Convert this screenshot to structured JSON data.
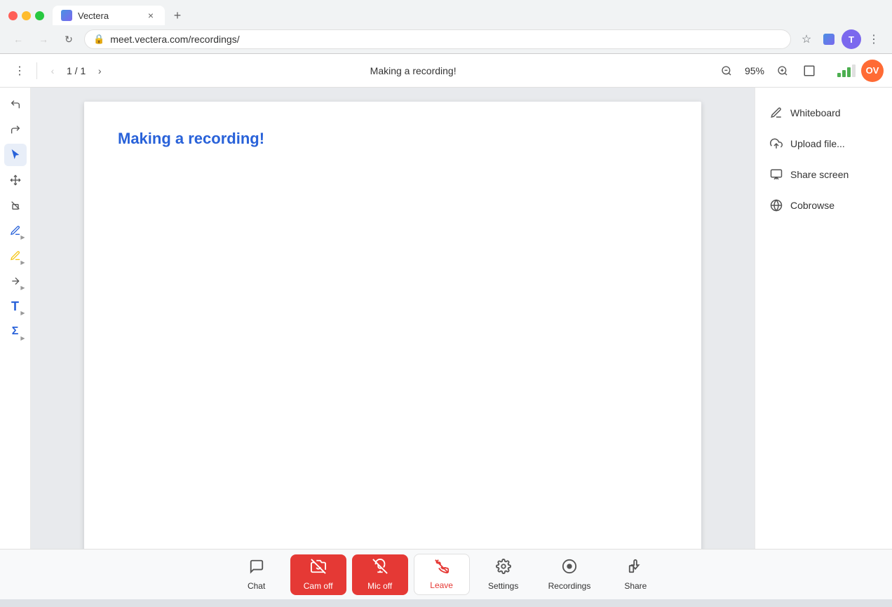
{
  "browser": {
    "tab_title": "Vectera",
    "url": "meet.vectera.com/recordings/",
    "profile_initials": "T",
    "new_tab_label": "+"
  },
  "toolbar": {
    "page_current": "1",
    "page_total": "1",
    "doc_title": "Making a recording!",
    "zoom_level": "95%",
    "user_initials": "OV"
  },
  "document": {
    "title": "Making a recording!"
  },
  "right_panel": {
    "items": [
      {
        "id": "whiteboard",
        "label": "Whiteboard"
      },
      {
        "id": "upload-file",
        "label": "Upload file..."
      },
      {
        "id": "share-screen",
        "label": "Share screen"
      },
      {
        "id": "cobrowse",
        "label": "Cobrowse"
      }
    ]
  },
  "bottom_toolbar": {
    "chat_label": "Chat",
    "cam_off_label": "Cam off",
    "mic_off_label": "Mic off",
    "leave_label": "Leave",
    "settings_label": "Settings",
    "recordings_label": "Recordings",
    "share_label": "Share"
  }
}
